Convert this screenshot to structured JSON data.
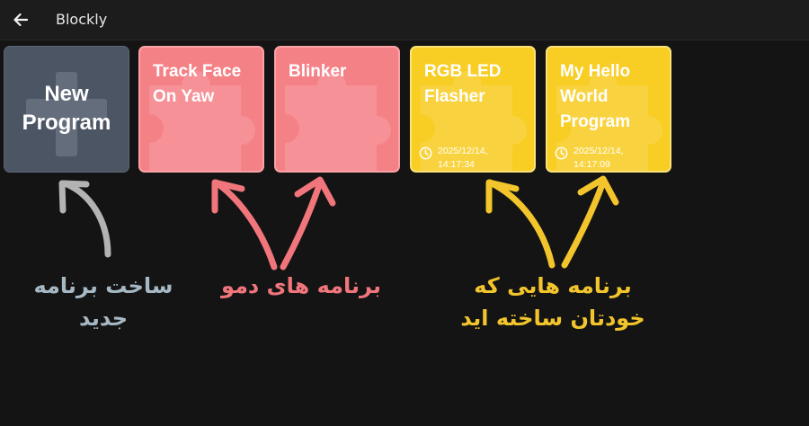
{
  "app_bar": {
    "title": "Blockly",
    "back_icon": "arrow-left-icon"
  },
  "cards": {
    "new_program": {
      "label": "New\nProgram",
      "icon": "plus-icon",
      "color": "#4c5564"
    },
    "demos": [
      {
        "label": "Track Face\nOn Yaw",
        "icon": "puzzle-piece-icon",
        "color": "#f48186"
      },
      {
        "label": "Blinker",
        "icon": "puzzle-piece-icon",
        "color": "#f48186"
      }
    ],
    "user_programs": [
      {
        "label": "RGB LED\nFlasher",
        "date": "2025/12/14,\n14:17:34",
        "icon": "clock-icon",
        "color": "#f8cd24"
      },
      {
        "label": "My Hello\nWorld\nProgram",
        "date": "2025/12/14,\n14:17:09",
        "icon": "clock-icon",
        "color": "#f8cd24"
      }
    ]
  },
  "annotations": {
    "new_program": {
      "line1": "ساخت برنامه",
      "line2": "جدید",
      "color": "#a6b8c4"
    },
    "demos": {
      "line1": "برنامه های دمو",
      "color": "#f0767c"
    },
    "user_programs": {
      "line1": "برنامه هایی که",
      "line2": "خودتان ساخته اید",
      "color": "#f3c52c"
    }
  }
}
